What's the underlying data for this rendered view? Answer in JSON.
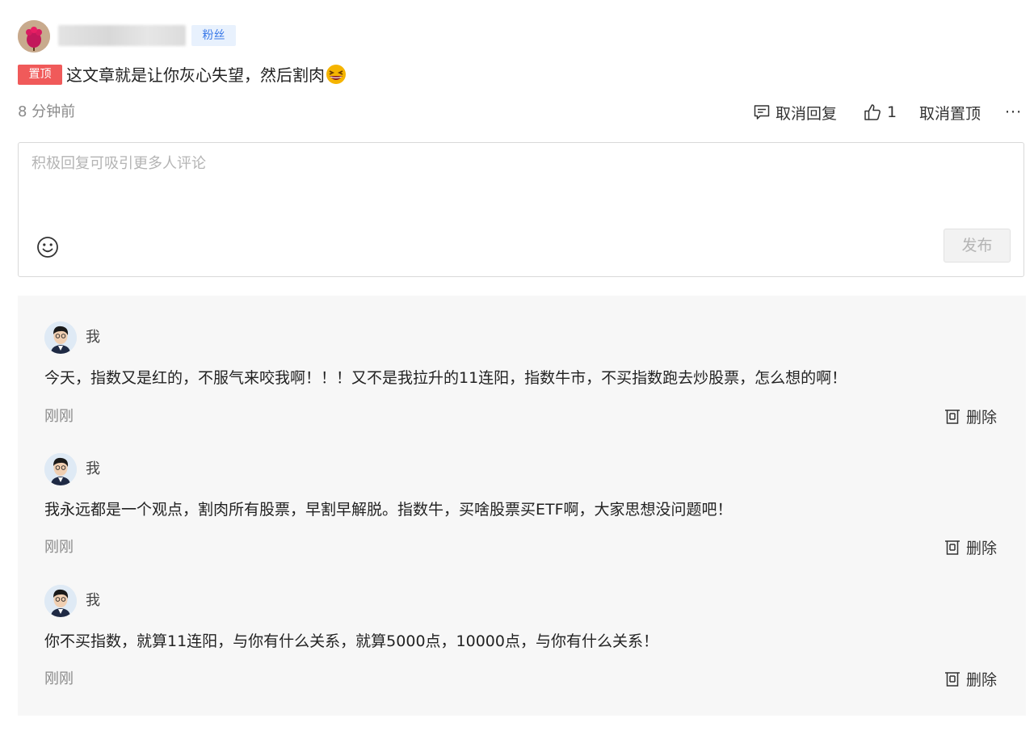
{
  "comment": {
    "fan_badge": "粉丝",
    "pin_badge": "置顶",
    "text": "这文章就是让你灰心失望，然后割肉",
    "time": "8 分钟前",
    "actions": {
      "cancel_reply": "取消回复",
      "like_count": "1",
      "cancel_pin": "取消置顶",
      "more": "···"
    }
  },
  "reply_box": {
    "placeholder": "积极回复可吸引更多人评论",
    "publish": "发布"
  },
  "replies": [
    {
      "name": "我",
      "text": "今天，指数又是红的，不服气来咬我啊！！！又不是我拉升的11连阳，指数牛市，不买指数跑去炒股票，怎么想的啊！",
      "time": "刚刚",
      "delete": "删除"
    },
    {
      "name": "我",
      "text": "我永远都是一个观点，割肉所有股票，早割早解脱。指数牛，买啥股票买ETF啊，大家思想没问题吧！",
      "time": "刚刚",
      "delete": "删除"
    },
    {
      "name": "我",
      "text": "你不买指数，就算11连阳，与你有什么关系，就算5000点，10000点，与你有什么关系！",
      "time": "刚刚",
      "delete": "删除"
    }
  ],
  "icons": {
    "avatar": "user-avatar",
    "emoji": "grinning-squint-emoji",
    "reply": "comment-icon",
    "like": "thumbs-up-icon",
    "smile": "smile-icon",
    "delete": "trash-icon"
  },
  "colors": {
    "pin_badge_bg": "#f05a5a",
    "fan_badge_bg": "#e8f1fd",
    "fan_badge_text": "#3b7ae8",
    "panel_bg": "#f7f7f7"
  }
}
